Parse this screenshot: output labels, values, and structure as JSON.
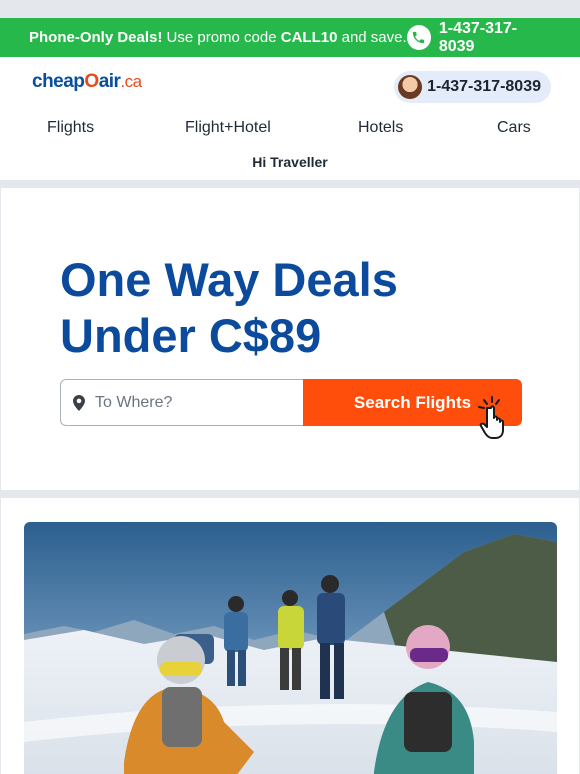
{
  "promo": {
    "bold": "Phone-Only Deals!",
    "text": " Use promo code ",
    "code": "CALL10",
    "tail": " and save.",
    "phone": "1-437-317-8039"
  },
  "header": {
    "logo_cheap": "cheap",
    "logo_o": "O",
    "logo_air": "air",
    "logo_tld": ".ca",
    "agent_phone": "1-437-317-8039",
    "nav": [
      "Flights",
      "Flight+Hotel",
      "Hotels",
      "Cars"
    ],
    "greeting": "Hi Traveller"
  },
  "hero": {
    "title_line1": "One Way Deals",
    "title_line2": "Under C$89",
    "search_placeholder": "To Where?",
    "search_button": "Search Flights"
  },
  "colors": {
    "promo_bg": "#27b84c",
    "brand_blue": "#0b4a9c",
    "brand_orange": "#ff4d0b"
  },
  "icons": [
    "phone-icon",
    "map-pin-icon",
    "hand-cursor-icon"
  ]
}
